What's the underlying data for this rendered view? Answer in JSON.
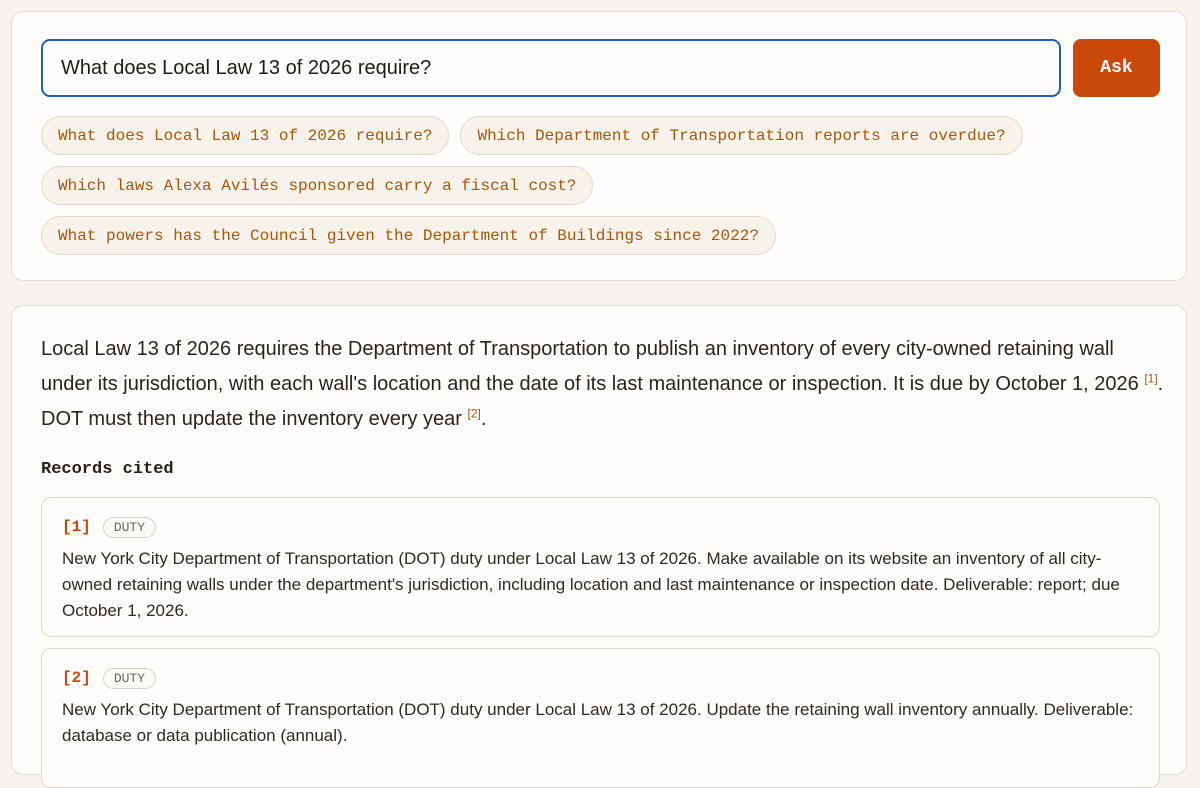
{
  "search": {
    "value": "What does Local Law 13 of 2026 require?",
    "ask_label": "Ask"
  },
  "suggestions": [
    "What does Local Law 13 of 2026 require?",
    "Which Department of Transportation reports are overdue?",
    "Which laws Alexa Avilés sponsored carry a fiscal cost?",
    "What powers has the Council given the Department of Buildings since 2022?"
  ],
  "answer": {
    "part1": "Local Law 13 of 2026 requires the Department of Transportation to publish an inventory of every city-owned retaining wall under its jurisdiction, with each wall's location and the date of its last maintenance or inspection. It is due by October 1, 2026 ",
    "cite1": "[1]",
    "part2": ". DOT must then update the inventory every year ",
    "cite2": "[2]",
    "part3": "."
  },
  "records": {
    "heading": "Records cited",
    "items": [
      {
        "num": "[1]",
        "tag": "DUTY",
        "text": "New York City Department of Transportation (DOT) duty under Local Law 13 of 2026. Make available on its website an inventory of all city-owned retaining walls under the department's jurisdiction, including location and last maintenance or inspection date. Deliverable: report; due October 1, 2026."
      },
      {
        "num": "[2]",
        "tag": "DUTY",
        "text": "New York City Department of Transportation (DOT) duty under Local Law 13 of 2026. Update the retaining wall inventory annually. Deliverable: database or data publication (annual)."
      }
    ]
  },
  "colors": {
    "accent": "#c8490a",
    "focus_border": "#1f5fae",
    "chip_text": "#a9560a"
  }
}
